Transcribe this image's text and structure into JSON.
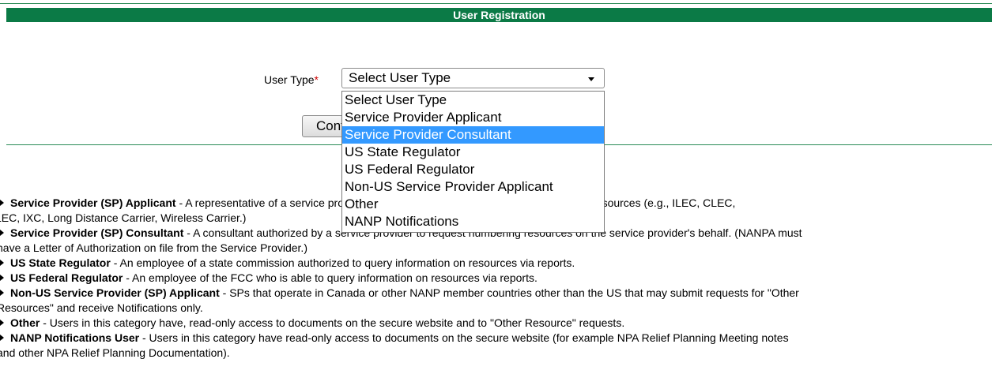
{
  "title": "User Registration",
  "form": {
    "user_type_label": "User Type",
    "required_marker": "*",
    "select_value": "Select User Type",
    "continue_label": "Continue",
    "options": [
      "Select User Type",
      "Service Provider Applicant",
      "Service Provider Consultant",
      "US State Regulator",
      "US Federal Regulator",
      "Non-US Service Provider Applicant",
      "Other",
      "NANP Notifications"
    ],
    "highlighted_option": "Service Provider Consultant"
  },
  "descriptions": [
    {
      "term": "Service Provider (SP) Applicant",
      "line1": " - A representative of a service provider requesting assignments of NANP numbering resources (e.g., ILEC, CLEC,",
      "line2": "LEC, IXC, Long Distance Carrier, Wireless Carrier.)"
    },
    {
      "term": "Service Provider (SP) Consultant",
      "line1": " - A consultant authorized by a service provider to request numbering resources on the service provider's behalf. (NANPA must",
      "line2": "have a Letter of Authorization on file from the Service Provider.)"
    },
    {
      "term": "US State Regulator",
      "line1": " - An employee of a state commission authorized to query information on resources via reports.",
      "line2": ""
    },
    {
      "term": "US Federal Regulator",
      "line1": " - An employee of the FCC who is able to query information on resources via reports.",
      "line2": ""
    },
    {
      "term": "Non-US Service Provider (SP) Applicant",
      "line1": " - SPs that operate in Canada or other NANP member countries other than the US that may submit requests for \"Other",
      "line2": "Resources\" and receive Notifications only."
    },
    {
      "term": "Other",
      "line1": " - Users in this category have, read-only access to documents on the secure website and to \"Other Resource\" requests.",
      "line2": ""
    },
    {
      "term": "NANP Notifications User",
      "line1": " - Users in this category have read-only access to documents on the secure website (for example NPA Relief Planning Meeting notes",
      "line2": "and other NPA Relief Planning Documentation)."
    }
  ]
}
